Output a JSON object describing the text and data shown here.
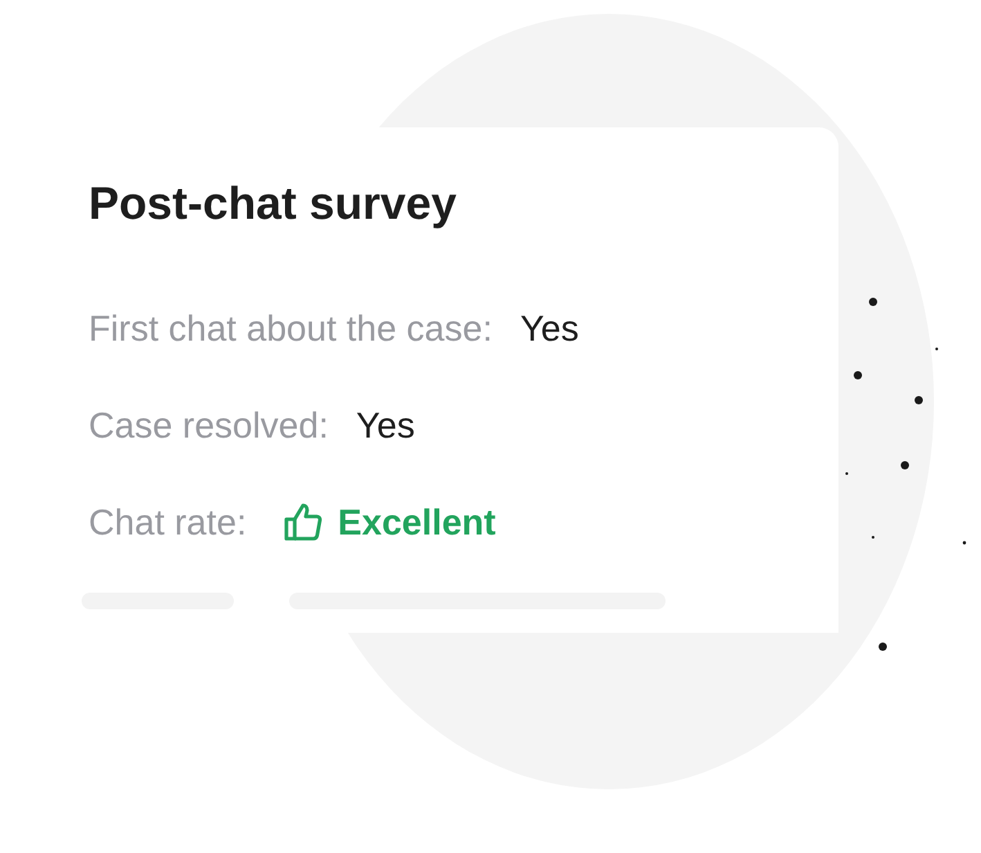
{
  "card": {
    "title": "Post-chat survey",
    "rows": [
      {
        "kind": "text",
        "label": "First chat about the case:",
        "value": "Yes"
      },
      {
        "kind": "text",
        "label": "Case resolved:",
        "value": "Yes"
      },
      {
        "kind": "rating",
        "label": "Chat rate:",
        "value": "Excellent",
        "color": "#22a45d"
      }
    ]
  }
}
